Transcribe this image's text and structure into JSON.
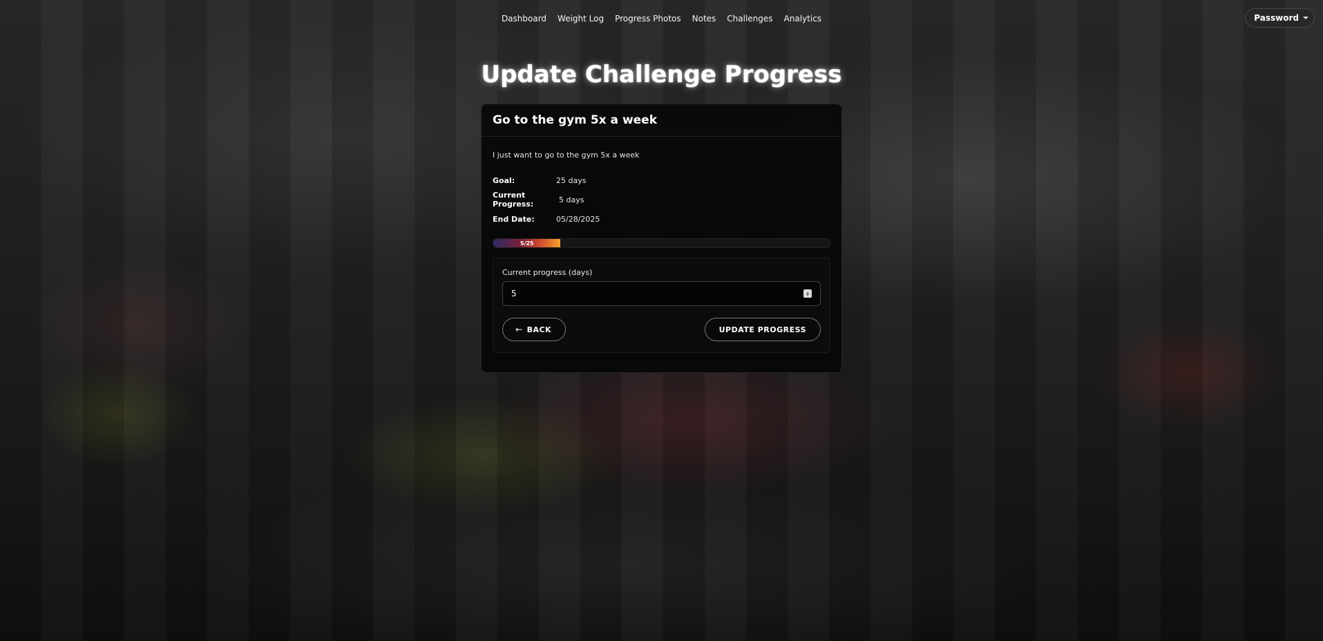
{
  "nav": {
    "items": [
      {
        "label": "Dashboard"
      },
      {
        "label": "Weight Log"
      },
      {
        "label": "Progress Photos"
      },
      {
        "label": "Notes"
      },
      {
        "label": "Challenges"
      },
      {
        "label": "Analytics"
      }
    ]
  },
  "user_menu": {
    "label": "Password"
  },
  "page": {
    "title": "Update Challenge Progress"
  },
  "challenge": {
    "title": "Go to the gym 5x a week",
    "description": "I just want to go to the gym 5x a week",
    "goal_label": "Goal:",
    "goal_value": "25 days",
    "current_label": "Current Progress:",
    "current_value": "5 days",
    "end_label": "End Date:",
    "end_value": "05/28/2025",
    "progress_text": "5/25",
    "progress_fraction": 0.2
  },
  "form": {
    "field_label": "Current progress (days)",
    "field_value": "5",
    "back_label": "BACK",
    "back_icon": "arrow-left-icon",
    "submit_label": "UPDATE PROGRESS"
  },
  "colors": {
    "progress_start": "#2c2a66",
    "progress_end": "#f2a32c",
    "card_bg": "#060606"
  }
}
